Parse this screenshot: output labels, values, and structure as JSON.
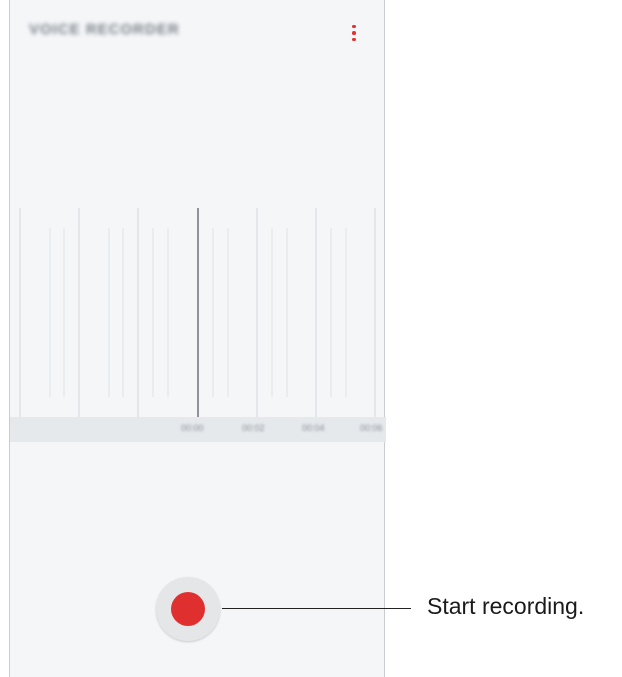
{
  "app": {
    "title": "VOICE RECORDER",
    "menu_icon": "more-vertical-icon"
  },
  "timeline": {
    "tick_labels": [
      "00:00",
      "00:02",
      "00:04",
      "00:06"
    ]
  },
  "record": {
    "icon": "record-icon",
    "callout": "Start recording."
  },
  "colors": {
    "accent": "#e02f2f",
    "background": "#f4f6f8",
    "strip": "#e6e9ec"
  }
}
